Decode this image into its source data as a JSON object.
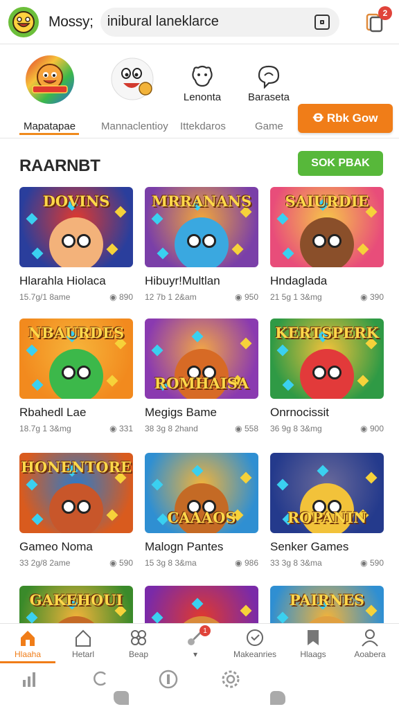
{
  "header": {
    "brand": "Mossy;",
    "search_value": "inibural laneklarce",
    "notification_count": "2"
  },
  "categories": [
    {
      "label": "Mapatapae",
      "active": true
    },
    {
      "label": "Mannaclentioy",
      "active": false
    },
    {
      "label": "Ittekdaros",
      "sub": "Lenonta",
      "active": false
    },
    {
      "label": "Game",
      "sub": "Baraseta",
      "active": false
    }
  ],
  "category_cta": "Ꝋ Rbk Gow",
  "section": {
    "title": "RAARNBT",
    "cta": "SOK PBAK"
  },
  "games": [
    {
      "thumb_title": "DOVINS",
      "name": "Hlarahla Hiolaca",
      "meta_left": "15.7g/1 8ame",
      "meta_right": "◉ 890"
    },
    {
      "thumb_title": "MRRANANS",
      "name": "Hibuyr!Multlan",
      "meta_left": "12 7b 1 2&am",
      "meta_right": "◉ 950"
    },
    {
      "thumb_title": "SAIURDIE",
      "name": "Hndaglada",
      "meta_left": "21 5g 1 3&mg",
      "meta_right": "◉ 390"
    },
    {
      "thumb_title": "NBAURDES",
      "name": "Rbahedl Lae",
      "meta_left": "18.7g 1 3&mg",
      "meta_right": "◉ 331"
    },
    {
      "thumb_title": "ROMHAISA",
      "name": "Megigs Bame",
      "meta_left": "38 3g 8 2hand",
      "meta_right": "◉ 558"
    },
    {
      "thumb_title": "KERTSPERK",
      "name": "Onrnocissit",
      "meta_left": "36 9g 8 3&mg",
      "meta_right": "◉ 900"
    },
    {
      "thumb_title": "HONENTORE",
      "name": "Gameo Noma",
      "meta_left": "33 2g/8 2ame",
      "meta_right": "◉ 590"
    },
    {
      "thumb_title": "CAAAOS",
      "name": "Malogn Pantes",
      "meta_left": "15 3g 8 3&ma",
      "meta_right": "◉ 986"
    },
    {
      "thumb_title": "ROPANIN",
      "name": "Senker Games",
      "meta_left": "33 3g 8 3&ma",
      "meta_right": "◉ 590"
    },
    {
      "thumb_title": "GAKEHOUI",
      "name": "",
      "meta_left": "",
      "meta_right": ""
    },
    {
      "thumb_title": "",
      "name": "",
      "meta_left": "",
      "meta_right": ""
    },
    {
      "thumb_title": "PAIRNES",
      "name": "",
      "meta_left": "",
      "meta_right": ""
    }
  ],
  "thumb_colors": [
    [
      "#2a3e9c",
      "#e0392e",
      "#f3b27a"
    ],
    [
      "#7a3fa8",
      "#f2a63a",
      "#3aa8e0"
    ],
    [
      "#e84d7a",
      "#f6c54a",
      "#8a4f2a"
    ],
    [
      "#f28a1e",
      "#f6b43a",
      "#3cb84a"
    ],
    [
      "#8a3ab0",
      "#f2a646",
      "#d76a25"
    ],
    [
      "#2f9a45",
      "#f4c23a",
      "#e23a3a"
    ],
    [
      "#d95b1e",
      "#2d7ac8",
      "#c8562a"
    ],
    [
      "#2f8fd2",
      "#f2b33a",
      "#c46a25"
    ],
    [
      "#243a8c",
      "#6a6a9a",
      "#f2c23a"
    ],
    [
      "#3a8a2a",
      "#f2b33a",
      "#c46a25"
    ],
    [
      "#7a2aa8",
      "#e0392e",
      "#d98a3a"
    ],
    [
      "#2f8fd2",
      "#f2b33a",
      "#e0a040"
    ]
  ],
  "bottom_nav": [
    {
      "label": "Hlaaha",
      "icon": "home-icon",
      "active": true
    },
    {
      "label": "Hetarl",
      "icon": "house-outline-icon",
      "active": false
    },
    {
      "label": "Beap",
      "icon": "flower-icon",
      "active": false
    },
    {
      "label": "▾",
      "icon": "rocket-icon",
      "active": false,
      "badge": "1"
    },
    {
      "label": "Makeanries",
      "icon": "clock-icon",
      "active": false
    },
    {
      "label": "Hlaags",
      "icon": "bookmark-icon",
      "active": false
    },
    {
      "label": "Aoabera",
      "icon": "user-icon",
      "active": false
    }
  ],
  "accent_colors": {
    "orange": "#f07d18",
    "green": "#57b83a",
    "red": "#e0433a"
  }
}
